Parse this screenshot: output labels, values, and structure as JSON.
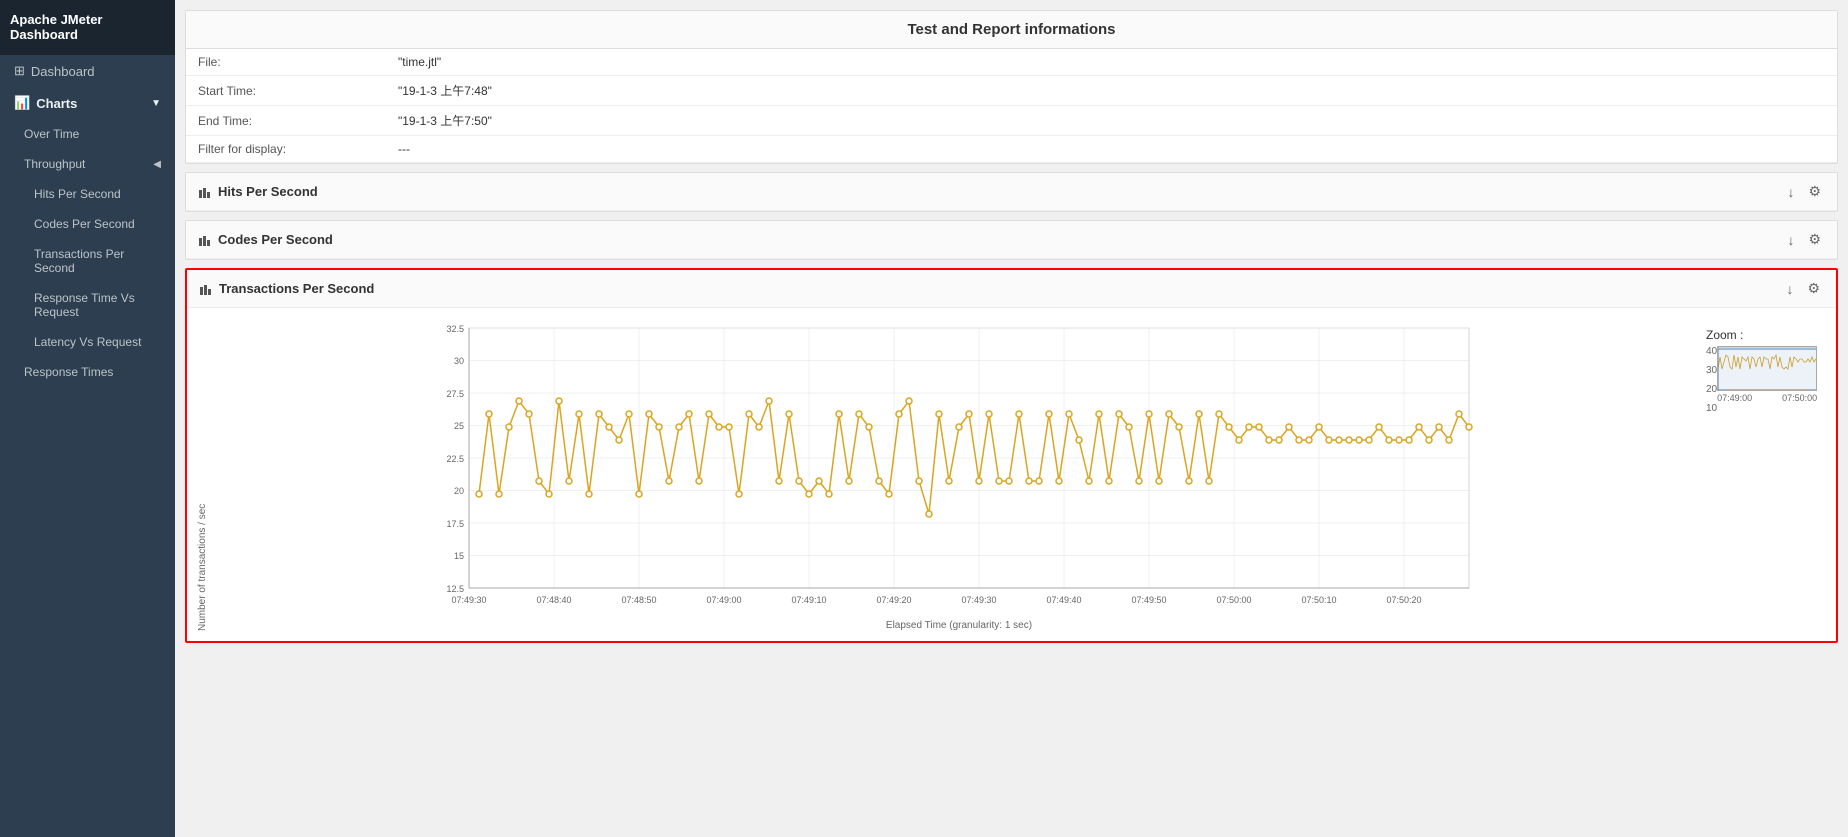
{
  "app": {
    "title": "Apache JMeter Dashboard"
  },
  "sidebar": {
    "dashboard_label": "Dashboard",
    "charts_label": "Charts",
    "over_time_label": "Over Time",
    "throughput_label": "Throughput",
    "hits_per_second_label": "Hits Per Second",
    "codes_per_second_label": "Codes Per Second",
    "transactions_per_second_label": "Transactions Per Second",
    "response_time_vs_request_label": "Response Time Vs Request",
    "latency_vs_request_label": "Latency Vs Request",
    "response_times_label": "Response Times"
  },
  "info_panel": {
    "title": "Test and Report informations",
    "file_label": "File:",
    "file_value": "\"time.jtl\"",
    "start_time_label": "Start Time:",
    "start_time_value": "\"19-1-3 上午7:48\"",
    "end_time_label": "End Time:",
    "end_time_value": "\"19-1-3 上午7:50\"",
    "filter_label": "Filter for display:",
    "filter_value": "---"
  },
  "hits_per_second": {
    "title": "Hits Per Second"
  },
  "codes_per_second": {
    "title": "Codes Per Second"
  },
  "transactions_per_second": {
    "title": "Transactions Per Second",
    "y_axis_label": "Number of transactions / sec",
    "x_axis_label": "Elapsed Time (granularity: 1 sec)",
    "x_ticks": [
      "07:49:30",
      "07:48:40",
      "07:48:50",
      "07:49:00",
      "07:49:10",
      "07:49:20",
      "07:49:30",
      "07:49:40",
      "07:49:50",
      "07:50:00",
      "07:50:10",
      "07:50:20"
    ],
    "y_ticks": [
      "32.5",
      "30",
      "27.5",
      "25",
      "22.5",
      "20",
      "17.5",
      "15",
      "12.5"
    ],
    "zoom_label": "Zoom :",
    "zoom_y_ticks": [
      "40",
      "30",
      "20",
      "10"
    ],
    "zoom_x_ticks": [
      "07:49:00",
      "07:50:00"
    ]
  }
}
